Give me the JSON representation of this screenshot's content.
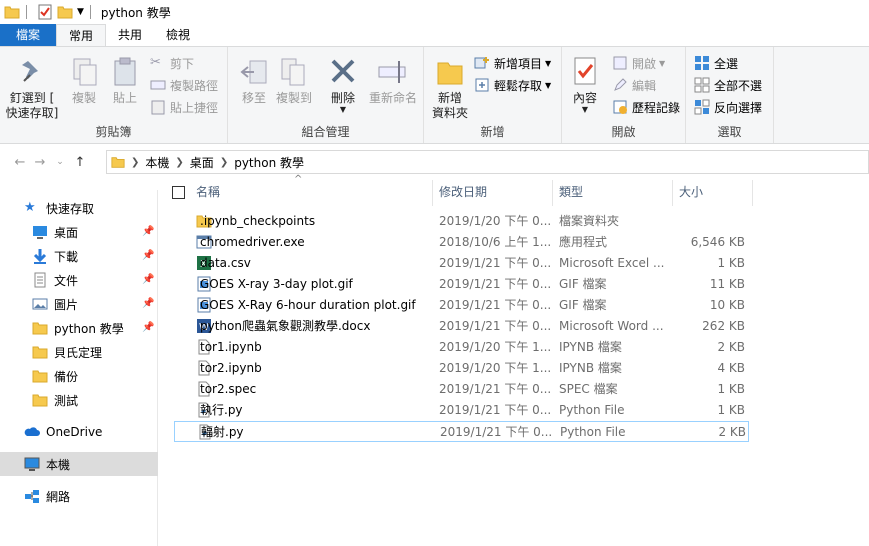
{
  "window": {
    "title": "python 教學"
  },
  "tabs": [
    "檔案",
    "常用",
    "共用",
    "檢視"
  ],
  "ribbon": {
    "clipboard": {
      "label": "剪貼簿",
      "pin_quick_access": "釘選到 [\n快速存取]",
      "copy": "複製",
      "paste": "貼上",
      "cut": "剪下",
      "copy_path": "複製路徑",
      "paste_shortcut": "貼上捷徑"
    },
    "organize": {
      "label": "組合管理",
      "move_to": "移至",
      "copy_to": "複製到",
      "delete": "刪除",
      "rename": "重新命名"
    },
    "new": {
      "label": "新增",
      "new_folder": "新增\n資料夾",
      "new_item": "新增項目",
      "easy_access": "輕鬆存取"
    },
    "open": {
      "label": "開啟",
      "properties": "內容",
      "open": "開啟",
      "edit": "編輯",
      "history": "歷程記錄"
    },
    "select": {
      "label": "選取",
      "select_all": "全選",
      "select_none": "全部不選",
      "invert": "反向選擇"
    }
  },
  "address": {
    "crumbs": [
      "本機",
      "桌面",
      "python 教學"
    ]
  },
  "nav_pane": {
    "items": [
      {
        "label": "快速存取",
        "icon": "star-icon"
      },
      {
        "label": "桌面",
        "icon": "desktop-icon",
        "pinned": true
      },
      {
        "label": "下載",
        "icon": "download-icon",
        "pinned": true
      },
      {
        "label": "文件",
        "icon": "document-icon",
        "pinned": true
      },
      {
        "label": "圖片",
        "icon": "picture-icon",
        "pinned": true
      },
      {
        "label": "python 教學",
        "icon": "folder-icon",
        "pinned": true
      },
      {
        "label": "貝氏定理",
        "icon": "folder-icon"
      },
      {
        "label": "備份",
        "icon": "folder-icon"
      },
      {
        "label": "測試",
        "icon": "folder-icon"
      },
      {
        "label": "OneDrive",
        "icon": "cloud-icon"
      },
      {
        "label": "本機",
        "icon": "computer-icon",
        "selected": true
      },
      {
        "label": "網路",
        "icon": "network-icon"
      }
    ]
  },
  "columns": [
    "名稱",
    "修改日期",
    "類型",
    "大小"
  ],
  "files": [
    {
      "name": ".ipynb_checkpoints",
      "date": "2019/1/20 下午 0...",
      "type": "檔案資料夾",
      "size": "",
      "icon": "folder-icon"
    },
    {
      "name": "chromedriver.exe",
      "date": "2018/10/6 上午 1...",
      "type": "應用程式",
      "size": "6,546 KB",
      "icon": "exe-icon"
    },
    {
      "name": "data.csv",
      "date": "2019/1/21 下午 0...",
      "type": "Microsoft Excel ...",
      "size": "1 KB",
      "icon": "excel-icon"
    },
    {
      "name": "GOES X-ray 3-day plot.gif",
      "date": "2019/1/21 下午 0...",
      "type": "GIF 檔案",
      "size": "11 KB",
      "icon": "image-icon"
    },
    {
      "name": "GOES X-Ray 6-hour duration plot.gif",
      "date": "2019/1/21 下午 0...",
      "type": "GIF 檔案",
      "size": "10 KB",
      "icon": "image-icon"
    },
    {
      "name": "python爬蟲氣象觀測教學.docx",
      "date": "2019/1/21 下午 0...",
      "type": "Microsoft Word ...",
      "size": "262 KB",
      "icon": "word-icon"
    },
    {
      "name": "tor1.ipynb",
      "date": "2019/1/20 下午 1...",
      "type": "IPYNB 檔案",
      "size": "2 KB",
      "icon": "file-icon"
    },
    {
      "name": "tor2.ipynb",
      "date": "2019/1/20 下午 1...",
      "type": "IPYNB 檔案",
      "size": "4 KB",
      "icon": "file-icon"
    },
    {
      "name": "tor2.spec",
      "date": "2019/1/21 下午 0...",
      "type": "SPEC 檔案",
      "size": "1 KB",
      "icon": "file-icon"
    },
    {
      "name": "執行.py",
      "date": "2019/1/21 下午 0...",
      "type": "Python File",
      "size": "1 KB",
      "icon": "python-file-icon"
    },
    {
      "name": "輻射.py",
      "date": "2019/1/21 下午 0...",
      "type": "Python File",
      "size": "2 KB",
      "icon": "python-file-icon",
      "focused": true
    }
  ],
  "colors": {
    "file_tab": "#1a70c8",
    "folder": "#f6c94e",
    "selected_nav": "#dcdcdc",
    "focus_border": "#99d1ff"
  }
}
